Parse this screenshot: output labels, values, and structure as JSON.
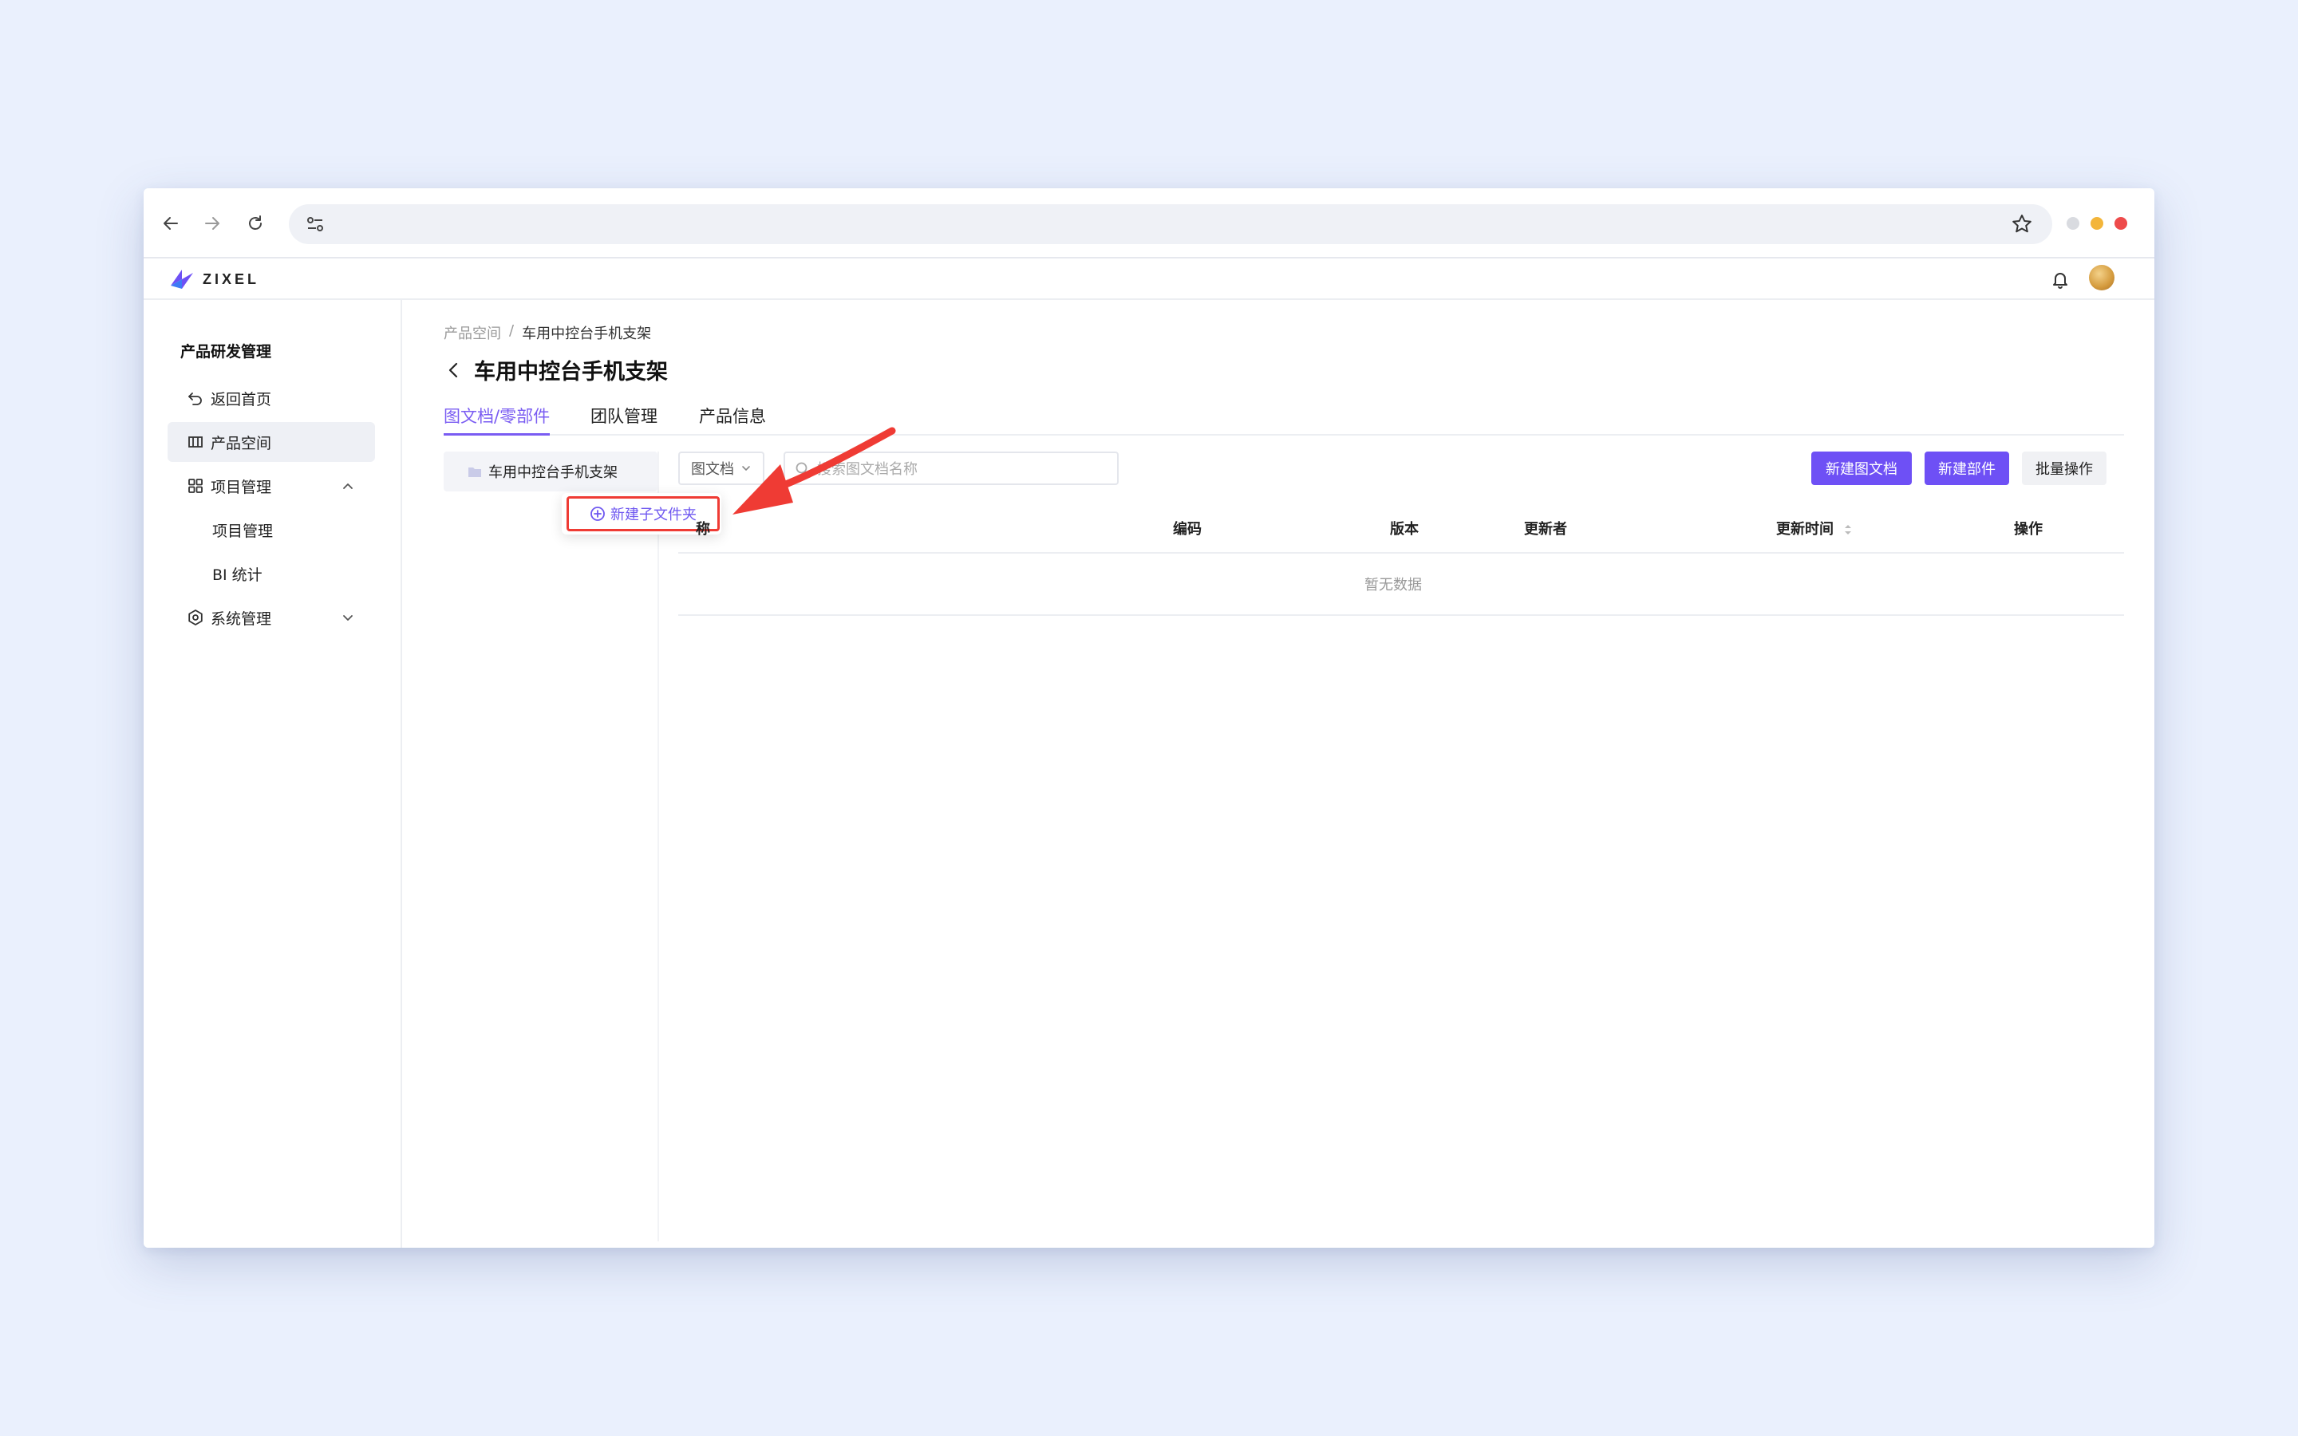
{
  "app": {
    "logo_text": "ZIXEL"
  },
  "sidebar": {
    "title": "产品研发管理",
    "items": [
      {
        "label": "返回首页"
      },
      {
        "label": "产品空间"
      },
      {
        "label": "项目管理"
      },
      {
        "label": "项目管理"
      },
      {
        "label": "BI 统计"
      },
      {
        "label": "系统管理"
      }
    ]
  },
  "breadcrumb": {
    "parent": "产品空间",
    "separator": "/",
    "current": "车用中控台手机支架"
  },
  "page": {
    "title": "车用中控台手机支架"
  },
  "tabs": [
    {
      "label": "图文档/零部件",
      "active": true
    },
    {
      "label": "团队管理",
      "active": false
    },
    {
      "label": "产品信息",
      "active": false
    }
  ],
  "folder_tree": {
    "root_label": "车用中控台手机支架"
  },
  "context_menu": {
    "new_subfolder_label": "新建子文件夹"
  },
  "toolbar": {
    "type_select_value": "图文档",
    "search_placeholder": "搜索图文档名称",
    "new_doc_label": "新建图文档",
    "new_part_label": "新建部件",
    "batch_label": "批量操作"
  },
  "table": {
    "columns": [
      "称",
      "编码",
      "版本",
      "更新者",
      "更新时间",
      "操作"
    ],
    "empty_text": "暂无数据"
  },
  "colors": {
    "accent": "#6e50f5",
    "annotation": "#ef3b34",
    "background": "#eaf0fd"
  }
}
